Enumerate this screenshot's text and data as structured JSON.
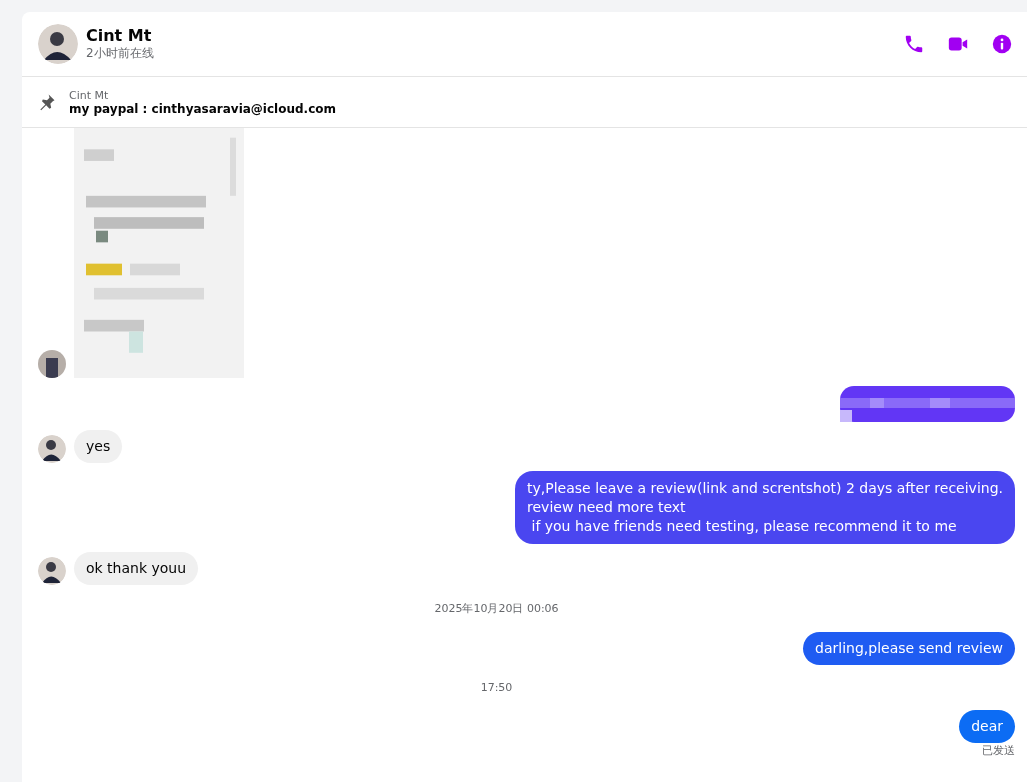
{
  "header": {
    "name": "Cint Mt",
    "presence": "2小时前在线"
  },
  "pinned": {
    "sender": "Cint Mt",
    "text": "my paypal : cinthyasaravia@icloud.com"
  },
  "messages": [
    {
      "kind": "picture-in"
    },
    {
      "kind": "picture-out"
    },
    {
      "kind": "incoming",
      "text": "yes"
    },
    {
      "kind": "outgoing",
      "color": "#4a46f0",
      "lines": [
        "ty,Please leave a review(link and screntshot) 2 days after receiving.",
        "review need more text",
        " if you have friends need testing, please recommend it to me"
      ]
    },
    {
      "kind": "incoming",
      "text": "ok thank youu"
    },
    {
      "kind": "time",
      "text": "2025年10月20日 00:06"
    },
    {
      "kind": "outgoing",
      "color": "#1f5cf2",
      "text": "darling,please send review"
    },
    {
      "kind": "time",
      "text": "17:50"
    },
    {
      "kind": "outgoing",
      "color": "#0c6cf4",
      "text": "dear",
      "status": "已发送"
    }
  ]
}
